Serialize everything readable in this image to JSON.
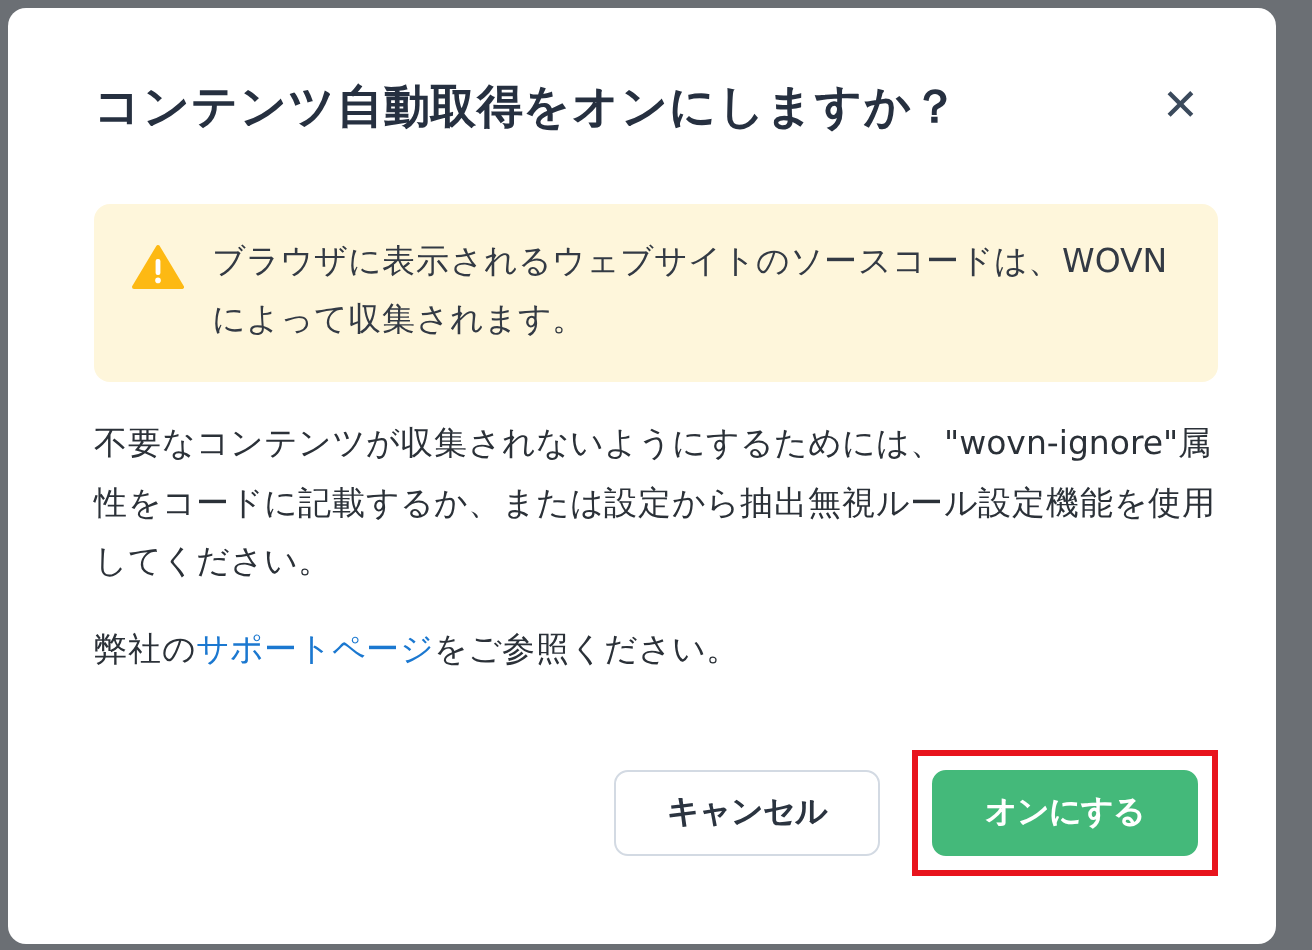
{
  "dialog": {
    "title": "コンテンツ自動取得をオンにしますか？",
    "close": "✕",
    "alert": {
      "kind": "warning",
      "text": "ブラウザに表示されるウェブサイトのソースコードは、WOVNによって収集されます。"
    },
    "body": "不要なコンテンツが収集されないようにするためには、\"wovn-ignore\"属性をコードに記載するか、または設定から抽出無視ルール設定機能を使用してください。",
    "note": {
      "before": "弊社の",
      "link": "サポートページ",
      "after": "をご参照ください。"
    },
    "buttons": [
      {
        "label": "キャンセル",
        "kind": "secondary",
        "highlighted": false
      },
      {
        "label": "オンにする",
        "kind": "primary",
        "highlighted": true
      }
    ]
  }
}
